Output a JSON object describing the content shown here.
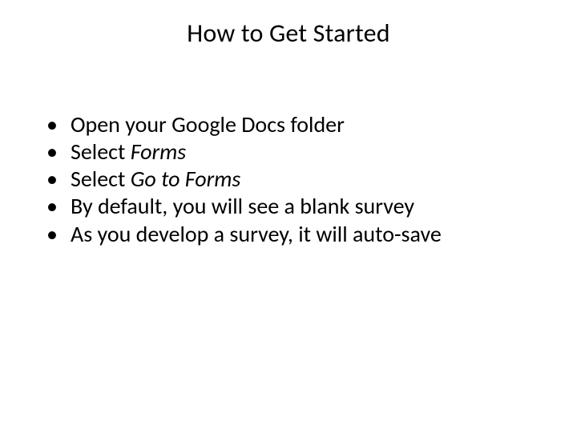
{
  "title": "How to Get Started",
  "bullets": [
    {
      "pre": "Open your Google Docs folder",
      "em": "",
      "post": ""
    },
    {
      "pre": "Select ",
      "em": "Forms",
      "post": ""
    },
    {
      "pre": "Select ",
      "em": "Go to Forms",
      "post": ""
    },
    {
      "pre": "By default, you will see a blank survey",
      "em": "",
      "post": ""
    },
    {
      "pre": "As you develop a survey, it will auto-save",
      "em": "",
      "post": ""
    }
  ]
}
